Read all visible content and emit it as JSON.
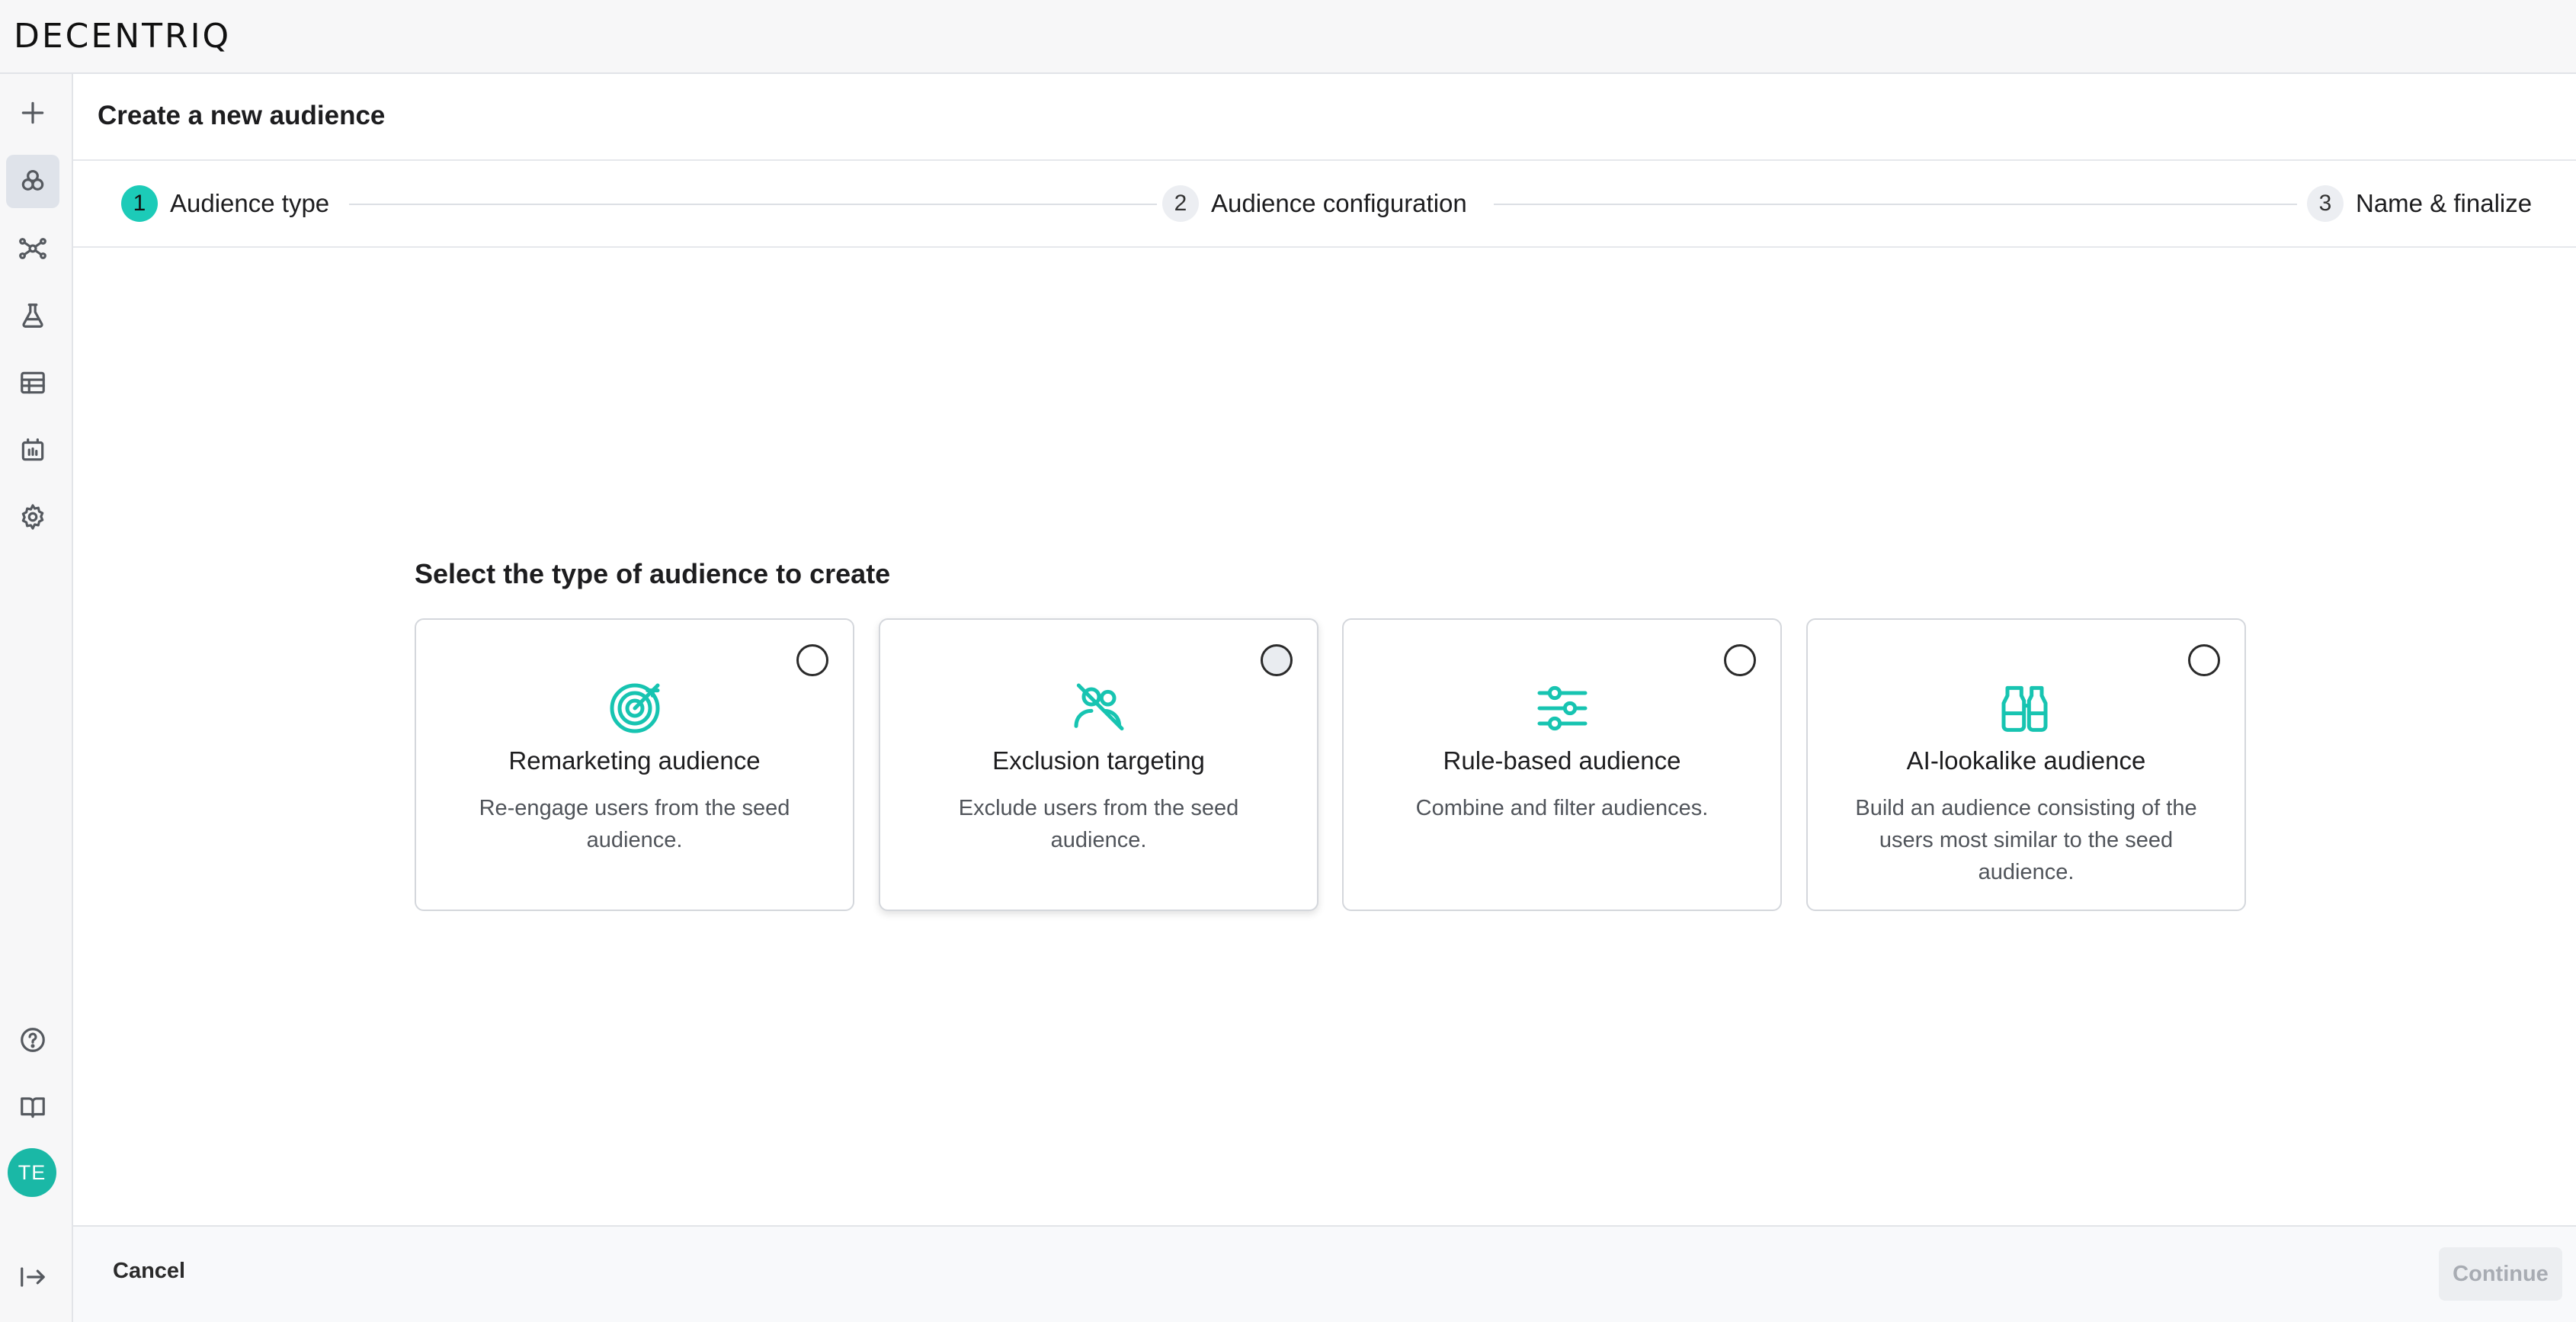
{
  "app": {
    "logo": "DECENTRIQ"
  },
  "sidebar": {
    "items": [
      {
        "icon": "plus-icon"
      },
      {
        "icon": "audiences-icon",
        "active": true
      },
      {
        "icon": "network-icon"
      },
      {
        "icon": "flask-icon"
      },
      {
        "icon": "table-icon"
      },
      {
        "icon": "datalab-icon"
      },
      {
        "icon": "gear-icon"
      }
    ],
    "bottom_items": [
      {
        "icon": "help-icon"
      },
      {
        "icon": "book-icon"
      }
    ],
    "avatar_initials": "TE",
    "collapse_icon": "expand-sidebar-icon"
  },
  "page": {
    "title": "Create a new audience"
  },
  "stepper": {
    "steps": [
      {
        "number": "1",
        "label": "Audience type",
        "active": true
      },
      {
        "number": "2",
        "label": "Audience configuration",
        "active": false
      },
      {
        "number": "3",
        "label": "Name & finalize",
        "active": false
      }
    ]
  },
  "selection": {
    "title": "Select the type of audience to create",
    "cards": [
      {
        "title": "Remarketing audience",
        "description": "Re-engage users from the seed audience.",
        "icon": "target-icon",
        "selected": false
      },
      {
        "title": "Exclusion targeting",
        "description": "Exclude users from the seed audience.",
        "icon": "user-excluded-icon",
        "selected": false,
        "hovered": true
      },
      {
        "title": "Rule-based audience",
        "description": "Combine and filter audiences.",
        "icon": "sliders-icon",
        "selected": false
      },
      {
        "title": "AI-lookalike audience",
        "description": "Build an audience consisting of the users most similar to the seed audience.",
        "icon": "binoculars-icon",
        "selected": false
      }
    ]
  },
  "footer": {
    "cancel_label": "Cancel",
    "continue_label": "Continue",
    "continue_disabled": true
  },
  "colors": {
    "accent": "#1ccbb8",
    "icon_accent": "#17c4b1",
    "avatar": "#1ab8a6"
  }
}
